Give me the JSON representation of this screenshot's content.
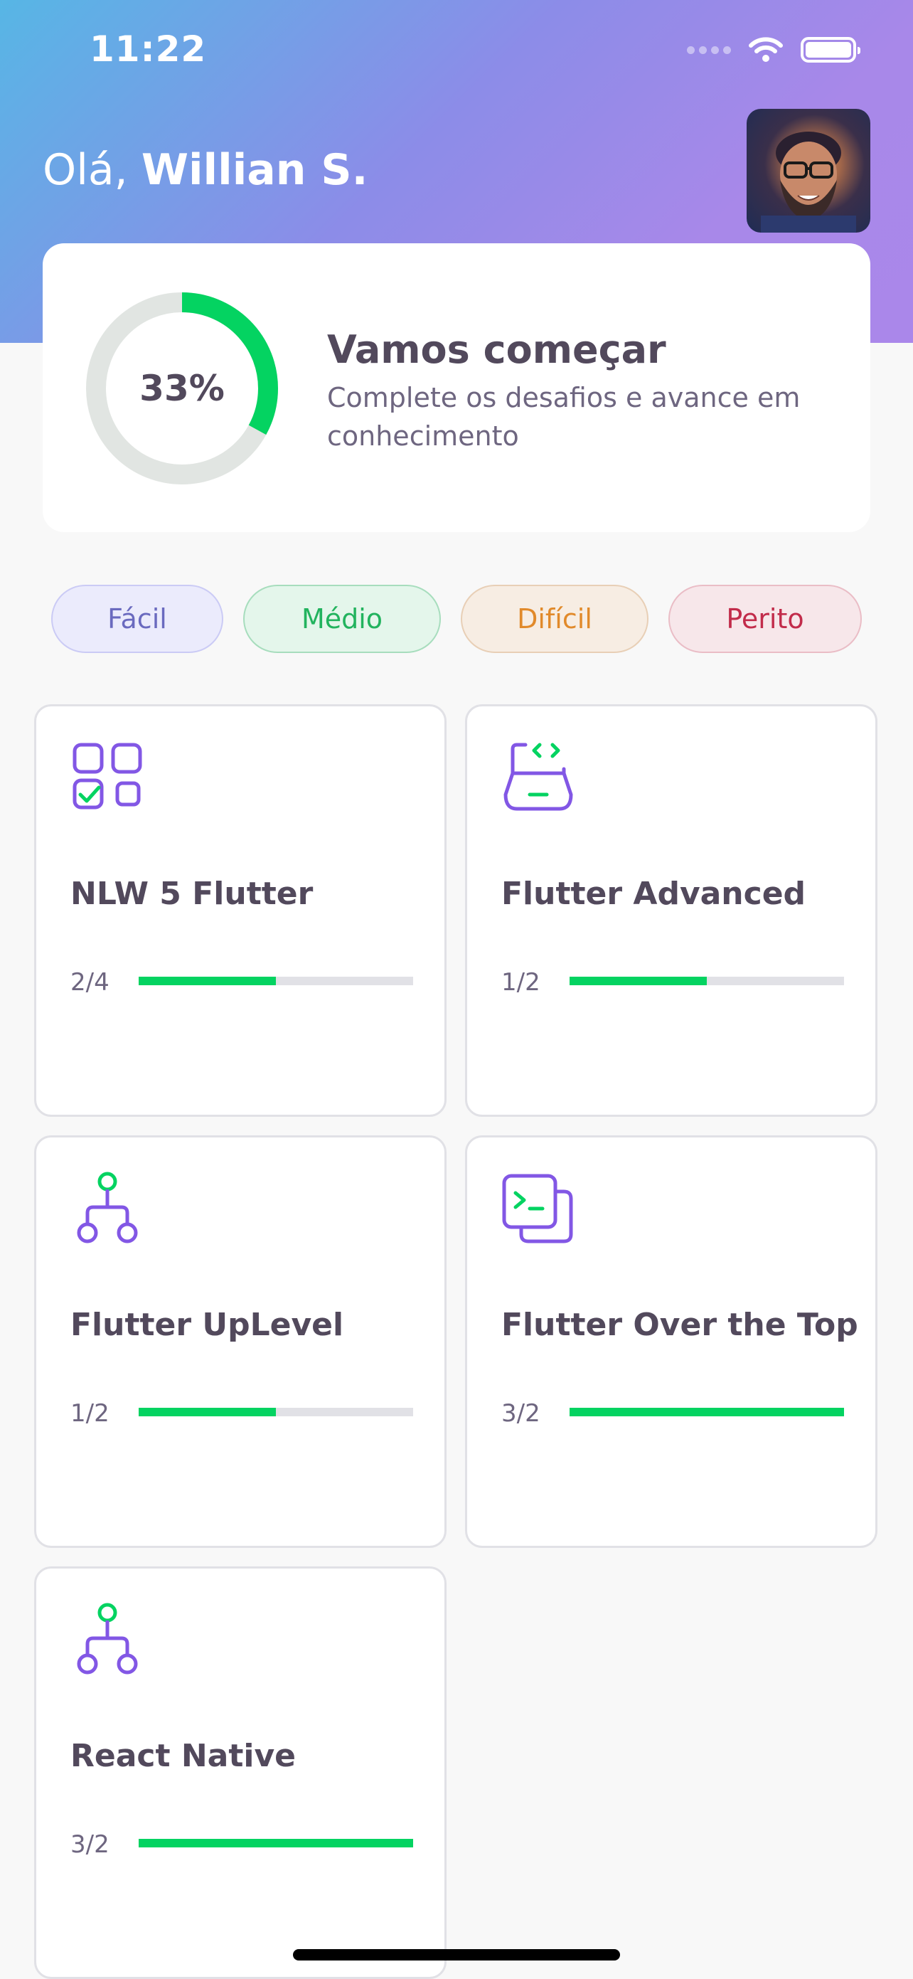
{
  "status_bar": {
    "time": "11:22",
    "wifi_icon": "wifi-icon",
    "battery_icon": "battery-icon"
  },
  "header": {
    "greeting_prefix": "Olá, ",
    "user_name": "Willian S.",
    "avatar": "user-avatar-photo"
  },
  "score_card": {
    "percent": 0.33,
    "percent_label": "33%",
    "title": "Vamos começar",
    "subtitle": "Complete os desafios e avance em conhecimento"
  },
  "levels": [
    {
      "label": "Fácil"
    },
    {
      "label": "Médio"
    },
    {
      "label": "Difícil"
    },
    {
      "label": "Perito"
    }
  ],
  "quizzes": [
    {
      "title": "NLW 5 Flutter",
      "progress_label": "2/4",
      "progress": 0.5,
      "icon": "blocks-icon"
    },
    {
      "title": "Flutter Advanced",
      "progress_label": "1/2",
      "progress": 0.5,
      "icon": "laptop-code-icon"
    },
    {
      "title": "Flutter UpLevel",
      "progress_label": "1/2",
      "progress": 0.5,
      "icon": "hierarchy-icon"
    },
    {
      "title": "Flutter Over the Top",
      "progress_label": "3/2",
      "progress": 1.0,
      "icon": "terminal-icon"
    },
    {
      "title": "React Native",
      "progress_label": "3/2",
      "progress": 1.0,
      "icon": "hierarchy-icon"
    }
  ],
  "colors": {
    "accent_purple": "#8257E5",
    "progress_green": "#04D361",
    "track_gray": "#E1E1E6",
    "text_dark": "#52495C",
    "gradient_start": "#57B6E5",
    "gradient_end": "#AA87EA"
  }
}
